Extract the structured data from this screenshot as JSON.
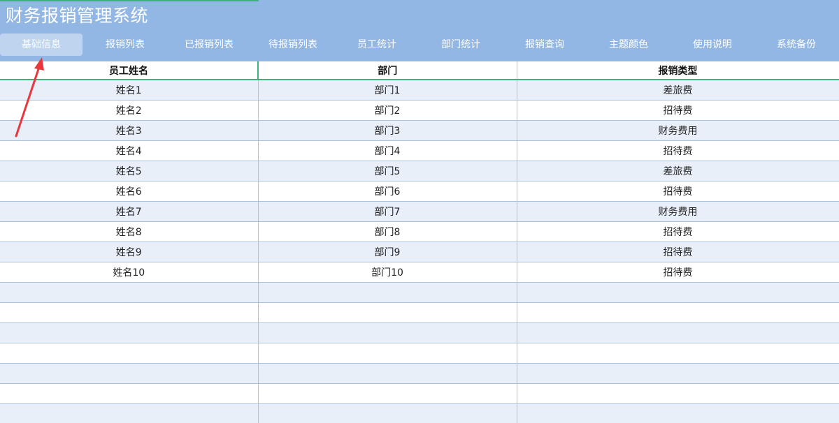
{
  "app": {
    "title": "财务报销管理系统"
  },
  "nav": {
    "tabs": [
      {
        "label": "基础信息",
        "active": true
      },
      {
        "label": "报销列表"
      },
      {
        "label": "已报销列表"
      },
      {
        "label": "待报销列表"
      },
      {
        "label": "员工统计"
      },
      {
        "label": "部门统计"
      },
      {
        "label": "报销查询"
      },
      {
        "label": "主题颜色"
      },
      {
        "label": "使用说明"
      },
      {
        "label": "系统备份"
      }
    ]
  },
  "table": {
    "columns": [
      "员工姓名",
      "部门",
      "报销类型"
    ],
    "rows": [
      [
        "姓名1",
        "部门1",
        "差旅费"
      ],
      [
        "姓名2",
        "部门2",
        "招待费"
      ],
      [
        "姓名3",
        "部门3",
        "财务费用"
      ],
      [
        "姓名4",
        "部门4",
        "招待费"
      ],
      [
        "姓名5",
        "部门5",
        "差旅费"
      ],
      [
        "姓名6",
        "部门6",
        "招待费"
      ],
      [
        "姓名7",
        "部门7",
        "财务费用"
      ],
      [
        "姓名8",
        "部门8",
        "招待费"
      ],
      [
        "姓名9",
        "部门9",
        "招待费"
      ],
      [
        "姓名10",
        "部门10",
        "招待费"
      ],
      [
        "",
        "",
        ""
      ],
      [
        "",
        "",
        ""
      ],
      [
        "",
        "",
        ""
      ],
      [
        "",
        "",
        ""
      ],
      [
        "",
        "",
        ""
      ],
      [
        "",
        "",
        ""
      ],
      [
        "",
        "",
        ""
      ]
    ]
  },
  "colors": {
    "header_bg": "#93b7e4",
    "active_tab": "#bfd4ef",
    "row_alt": "#e8eff9",
    "selection": "#39b47a",
    "annotation_arrow": "#e8383d"
  },
  "icons": {
    "annotation": "red-arrow-pointing-to-tab"
  }
}
